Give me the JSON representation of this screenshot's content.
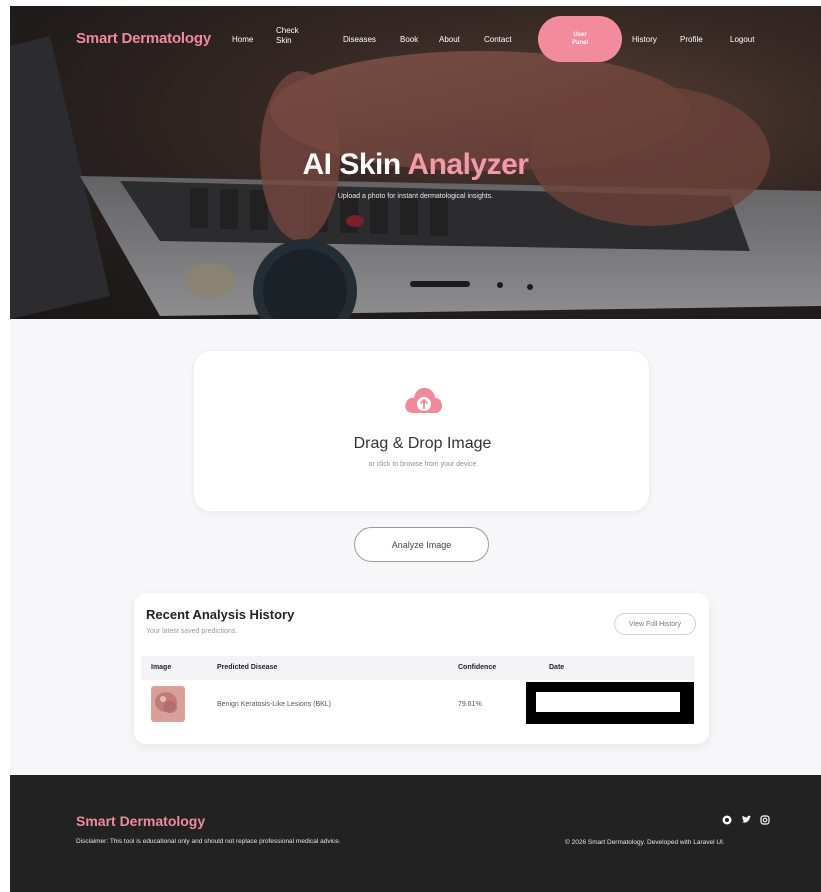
{
  "nav": {
    "brand": "Smart Dermatology",
    "links": {
      "home": "Home",
      "check_skin": "Check Skin",
      "diseases": "Diseases",
      "book": "Book",
      "about": "About",
      "contact": "Contact",
      "user_panel": "User Panel",
      "history": "History",
      "profile": "Profile",
      "logout": "Logout"
    }
  },
  "hero": {
    "title_main": "AI Skin ",
    "title_accent": "Analyzer",
    "subtitle": "Upload a photo for instant dermatological insights."
  },
  "upload": {
    "icon": "cloud-upload-icon",
    "title": "Drag & Drop Image",
    "subtitle": "or click to browse from your device"
  },
  "analyze_button": "Analyze Image",
  "history": {
    "title": "Recent Analysis History",
    "subtitle": "Your latest saved predictions.",
    "full_history_button": "View Full History",
    "columns": [
      "Image",
      "Predicted Disease",
      "Confidence",
      "Date"
    ],
    "rows": [
      {
        "predicted_disease": "Benign Keratosis-Like Lesions (BKL)",
        "confidence": "79.61%",
        "date": ""
      }
    ]
  },
  "footer": {
    "brand": "Smart Dermatology",
    "disclaimer": "Disclaimer: This tool is educational only and should not replace professional medical advice.",
    "social_icons": [
      "github-icon",
      "twitter-icon",
      "instagram-icon"
    ],
    "copyright": "© 2026 Smart Dermatology. Developed with Laravel UI."
  },
  "colors": {
    "accent": "#f08a9b",
    "footer_bg": "#222222",
    "page_bg": "#f7f7f9"
  }
}
